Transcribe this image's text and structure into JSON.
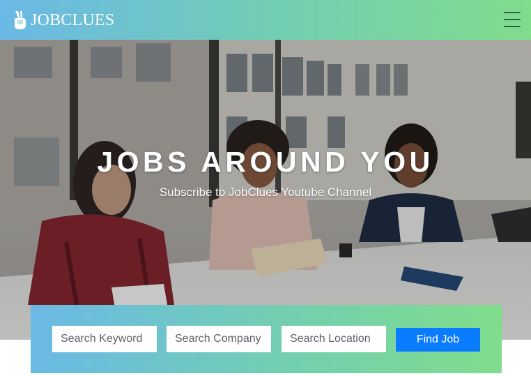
{
  "navbar": {
    "brand_name": "JOBCLUES",
    "brand_icon": "peace-hand-icon",
    "menu_icon": "hamburger-menu-icon"
  },
  "hero": {
    "title": "JOBS AROUND YOU",
    "subtitle": "Subscribe to JobClues Youtube Channel"
  },
  "search": {
    "keyword_placeholder": "Search Keyword",
    "company_placeholder": "Search Company",
    "location_placeholder": "Search Location",
    "button_label": "Find Job"
  },
  "colors": {
    "gradient_start": "#6ab9e6",
    "gradient_end": "#7fdd8c",
    "button": "#0a7cff"
  }
}
